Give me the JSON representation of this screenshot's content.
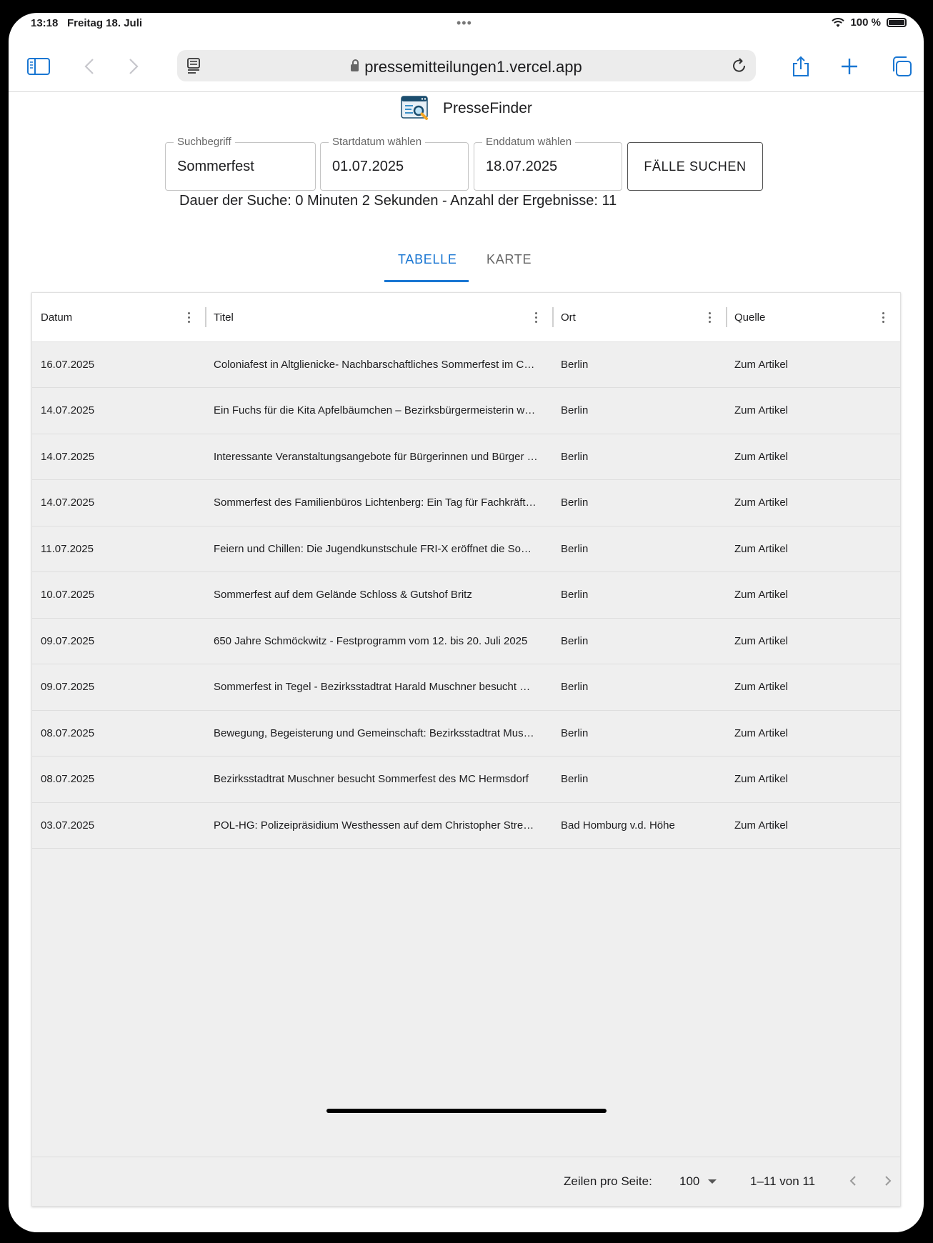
{
  "status_bar": {
    "time": "13:18",
    "date": "Freitag 18. Juli",
    "battery": "100 %"
  },
  "browser": {
    "url": "pressemitteilungen1.vercel.app"
  },
  "app": {
    "title": "PresseFinder"
  },
  "search_form": {
    "term_label": "Suchbegriff",
    "term_value": "Sommerfest",
    "start_label": "Startdatum wählen",
    "start_value": "01.07.2025",
    "end_label": "Enddatum wählen",
    "end_value": "18.07.2025",
    "search_button": "FÄLLE SUCHEN",
    "info": "Dauer der Suche: 0 Minuten 2 Sekunden - Anzahl der Ergebnisse: 11"
  },
  "tabs": [
    {
      "label": "TABELLE",
      "active": true
    },
    {
      "label": "KARTE",
      "active": false
    }
  ],
  "table": {
    "columns": [
      "Datum",
      "Titel",
      "Ort",
      "Quelle"
    ],
    "rows": [
      {
        "date": "16.07.2025",
        "title": "Coloniafest in Altglienicke- Nachbarschaftliches Sommerfest im C…",
        "place": "Berlin",
        "source": "Zum Artikel"
      },
      {
        "date": "14.07.2025",
        "title": "Ein Fuchs für die Kita Apfelbäumchen – Bezirksbürgermeisterin w…",
        "place": "Berlin",
        "source": "Zum Artikel"
      },
      {
        "date": "14.07.2025",
        "title": "Interessante Veranstaltungsangebote für Bürgerinnen und Bürger …",
        "place": "Berlin",
        "source": "Zum Artikel"
      },
      {
        "date": "14.07.2025",
        "title": "Sommerfest des Familienbüros Lichtenberg: Ein Tag für Fachkräft…",
        "place": "Berlin",
        "source": "Zum Artikel"
      },
      {
        "date": "11.07.2025",
        "title": "Feiern und Chillen: Die Jugendkunstschule FRI-X eröffnet die So…",
        "place": "Berlin",
        "source": "Zum Artikel"
      },
      {
        "date": "10.07.2025",
        "title": "Sommerfest auf dem Gelände Schloss & Gutshof Britz",
        "place": "Berlin",
        "source": "Zum Artikel"
      },
      {
        "date": "09.07.2025",
        "title": "650 Jahre Schmöckwitz - Festprogramm vom 12. bis 20. Juli 2025",
        "place": "Berlin",
        "source": "Zum Artikel"
      },
      {
        "date": "09.07.2025",
        "title": "Sommerfest in Tegel - Bezirksstadtrat Harald Muschner besucht …",
        "place": "Berlin",
        "source": "Zum Artikel"
      },
      {
        "date": "08.07.2025",
        "title": "Bewegung, Begeisterung und Gemeinschaft: Bezirksstadtrat Mus…",
        "place": "Berlin",
        "source": "Zum Artikel"
      },
      {
        "date": "08.07.2025",
        "title": "Bezirksstadtrat Muschner besucht Sommerfest des MC Hermsdorf",
        "place": "Berlin",
        "source": "Zum Artikel"
      },
      {
        "date": "03.07.2025",
        "title": "POL-HG: Polizeipräsidium Westhessen auf dem Christopher Stre…",
        "place": "Bad Homburg v.d. Höhe",
        "source": "Zum Artikel"
      }
    ]
  },
  "pagination": {
    "rows_per_page_label": "Zeilen pro Seite:",
    "rows_per_page_value": "100",
    "range": "1–11 von 11"
  }
}
